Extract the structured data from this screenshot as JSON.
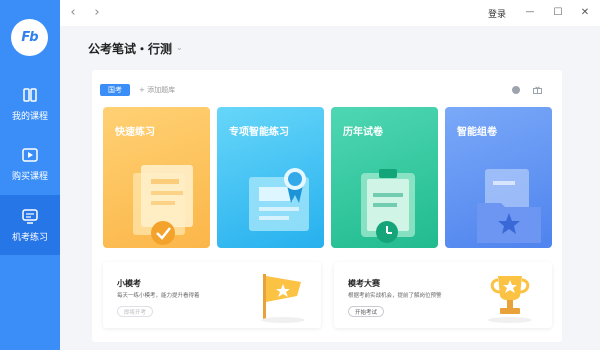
{
  "logo": {
    "text": "Fb"
  },
  "sidebar": {
    "items": [
      {
        "label": "我的课程",
        "icon": "book-icon",
        "active": false
      },
      {
        "label": "购买课程",
        "icon": "play-icon",
        "active": false
      },
      {
        "label": "机考练习",
        "icon": "monitor-icon",
        "active": true
      }
    ]
  },
  "topbar": {
    "back": "‹",
    "forward": "›",
    "login": "登录",
    "minimize": "—",
    "maximize": "☐",
    "close": "✕"
  },
  "header": {
    "title": "公考笔试・行测",
    "chevron": "⌄"
  },
  "filter": {
    "tag": "国考",
    "add_bank": "+ 添加题库"
  },
  "cards": [
    {
      "title": "快速练习",
      "color": "#fbb649"
    },
    {
      "title": "专项智能练习",
      "color": "#26b0ee"
    },
    {
      "title": "历年试卷",
      "color": "#21bb8e"
    },
    {
      "title": "智能组卷",
      "color": "#4f83ee"
    }
  ],
  "bottom_cards": [
    {
      "title": "小模考",
      "desc": "每天一练小模考，能力提升看得着",
      "button": "即将开考"
    },
    {
      "title": "模考大赛",
      "desc": "根据考前实战机会，提前了解岗位预警",
      "button": "开始考试"
    }
  ],
  "colors": {
    "sidebar": "#3b8ef7",
    "active": "#2776e8"
  }
}
